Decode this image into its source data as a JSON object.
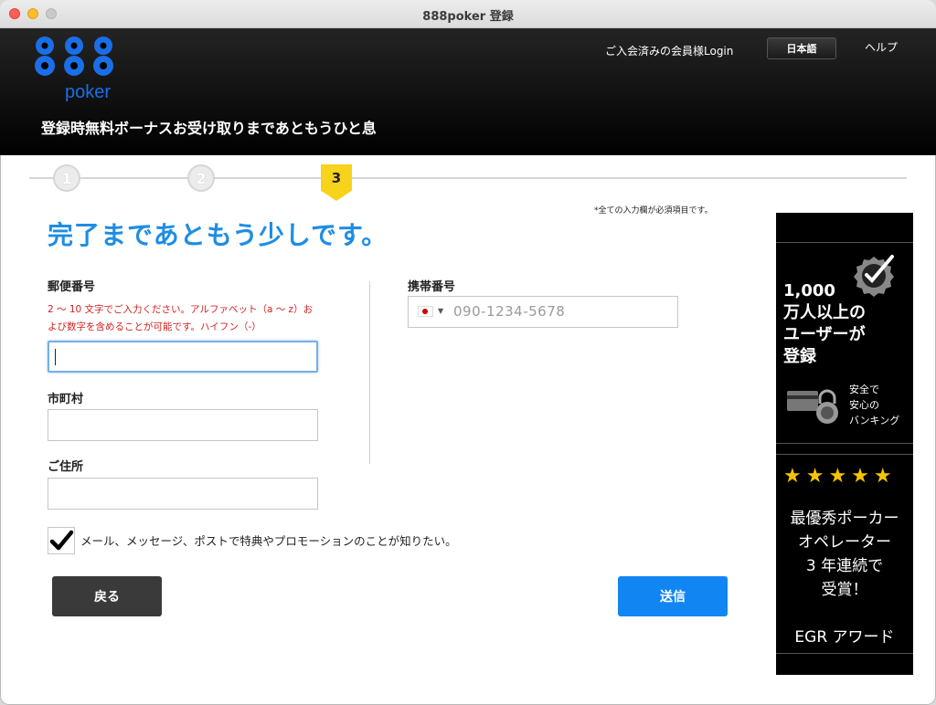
{
  "window": {
    "title": "888poker 登録"
  },
  "header": {
    "logo_top": "888",
    "logo_bottom": "poker",
    "login_link": "ご入会済みの会員様Login",
    "language_button": "日本語",
    "help_link": "ヘルプ",
    "tagline": "登録時無料ボーナスお受け取りまであともうひと息"
  },
  "stepper": {
    "steps": [
      "1",
      "2",
      "3"
    ],
    "active_step": "3",
    "active_color": "#f7d31b"
  },
  "form": {
    "required_note": "*全ての入力欄が必須項目です。",
    "title": "完了まであともう少しです。",
    "postal_code": {
      "label": "郵便番号",
      "hint": "2 〜 10 文字でご入力ください。アルファベット（a 〜 z）および数字を含めることが可能です。ハイフン（-）",
      "value": ""
    },
    "city": {
      "label": "市町村",
      "value": ""
    },
    "address": {
      "label": "ご住所",
      "value": ""
    },
    "mobile": {
      "label": "携帯番号",
      "placeholder": "090-1234-5678",
      "country": "JP"
    },
    "promo_checkbox": {
      "label": "メール、メッセージ、ポストで特典やプロモーションのことが知りたい。",
      "checked": true
    },
    "back_button": "戻る",
    "submit_button": "送信"
  },
  "banner": {
    "stat_line1": "1,000",
    "stat_line2": "万人以上の",
    "stat_line3": "ユーザーが",
    "stat_line4": "登録",
    "safe_line1": "安全で",
    "safe_line2": "安心の",
    "safe_line3": "バンキング",
    "stars": "★★★★★",
    "award_line1": "最優秀ポーカー",
    "award_line2": "オペレーター",
    "award_line3": "3 年連続で",
    "award_line4": "受賞！",
    "award_name": "EGR アワード"
  },
  "colors": {
    "accent_blue": "#1f8de3",
    "submit_blue": "#1186f2",
    "error_red": "#d42020",
    "logo_blue": "#1a6fe8"
  }
}
